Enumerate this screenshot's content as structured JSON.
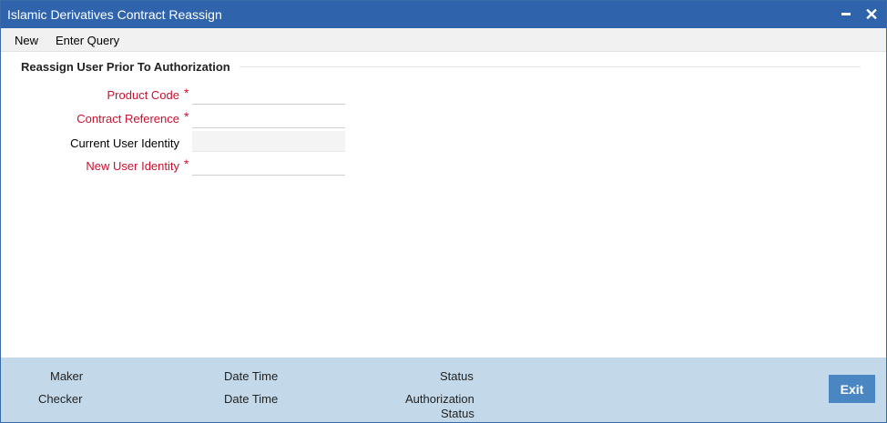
{
  "window": {
    "title": "Islamic Derivatives Contract Reassign",
    "minimize_icon": "minimize-icon",
    "close_icon": "close-icon",
    "close_glyph": "✕"
  },
  "menu": {
    "new": "New",
    "enter_query": "Enter Query"
  },
  "section": {
    "title": "Reassign User Prior To Authorization"
  },
  "form": {
    "required_marker": "*",
    "product_code": {
      "label": "Product Code",
      "value": ""
    },
    "contract_reference": {
      "label": "Contract Reference",
      "value": ""
    },
    "current_user_identity": {
      "label": "Current User Identity",
      "value": ""
    },
    "new_user_identity": {
      "label": "New User Identity",
      "value": ""
    }
  },
  "footer": {
    "maker": "Maker",
    "checker": "Checker",
    "date_time_1": "Date Time",
    "date_time_2": "Date Time",
    "status": "Status",
    "authorization_status_line1": "Authorization",
    "authorization_status_line2": "Status",
    "exit": "Exit"
  },
  "colors": {
    "titlebar": "#2f64ad",
    "required_label": "#c8102e",
    "footer": "#c3d9ea",
    "exit_button": "#4a86c2"
  }
}
